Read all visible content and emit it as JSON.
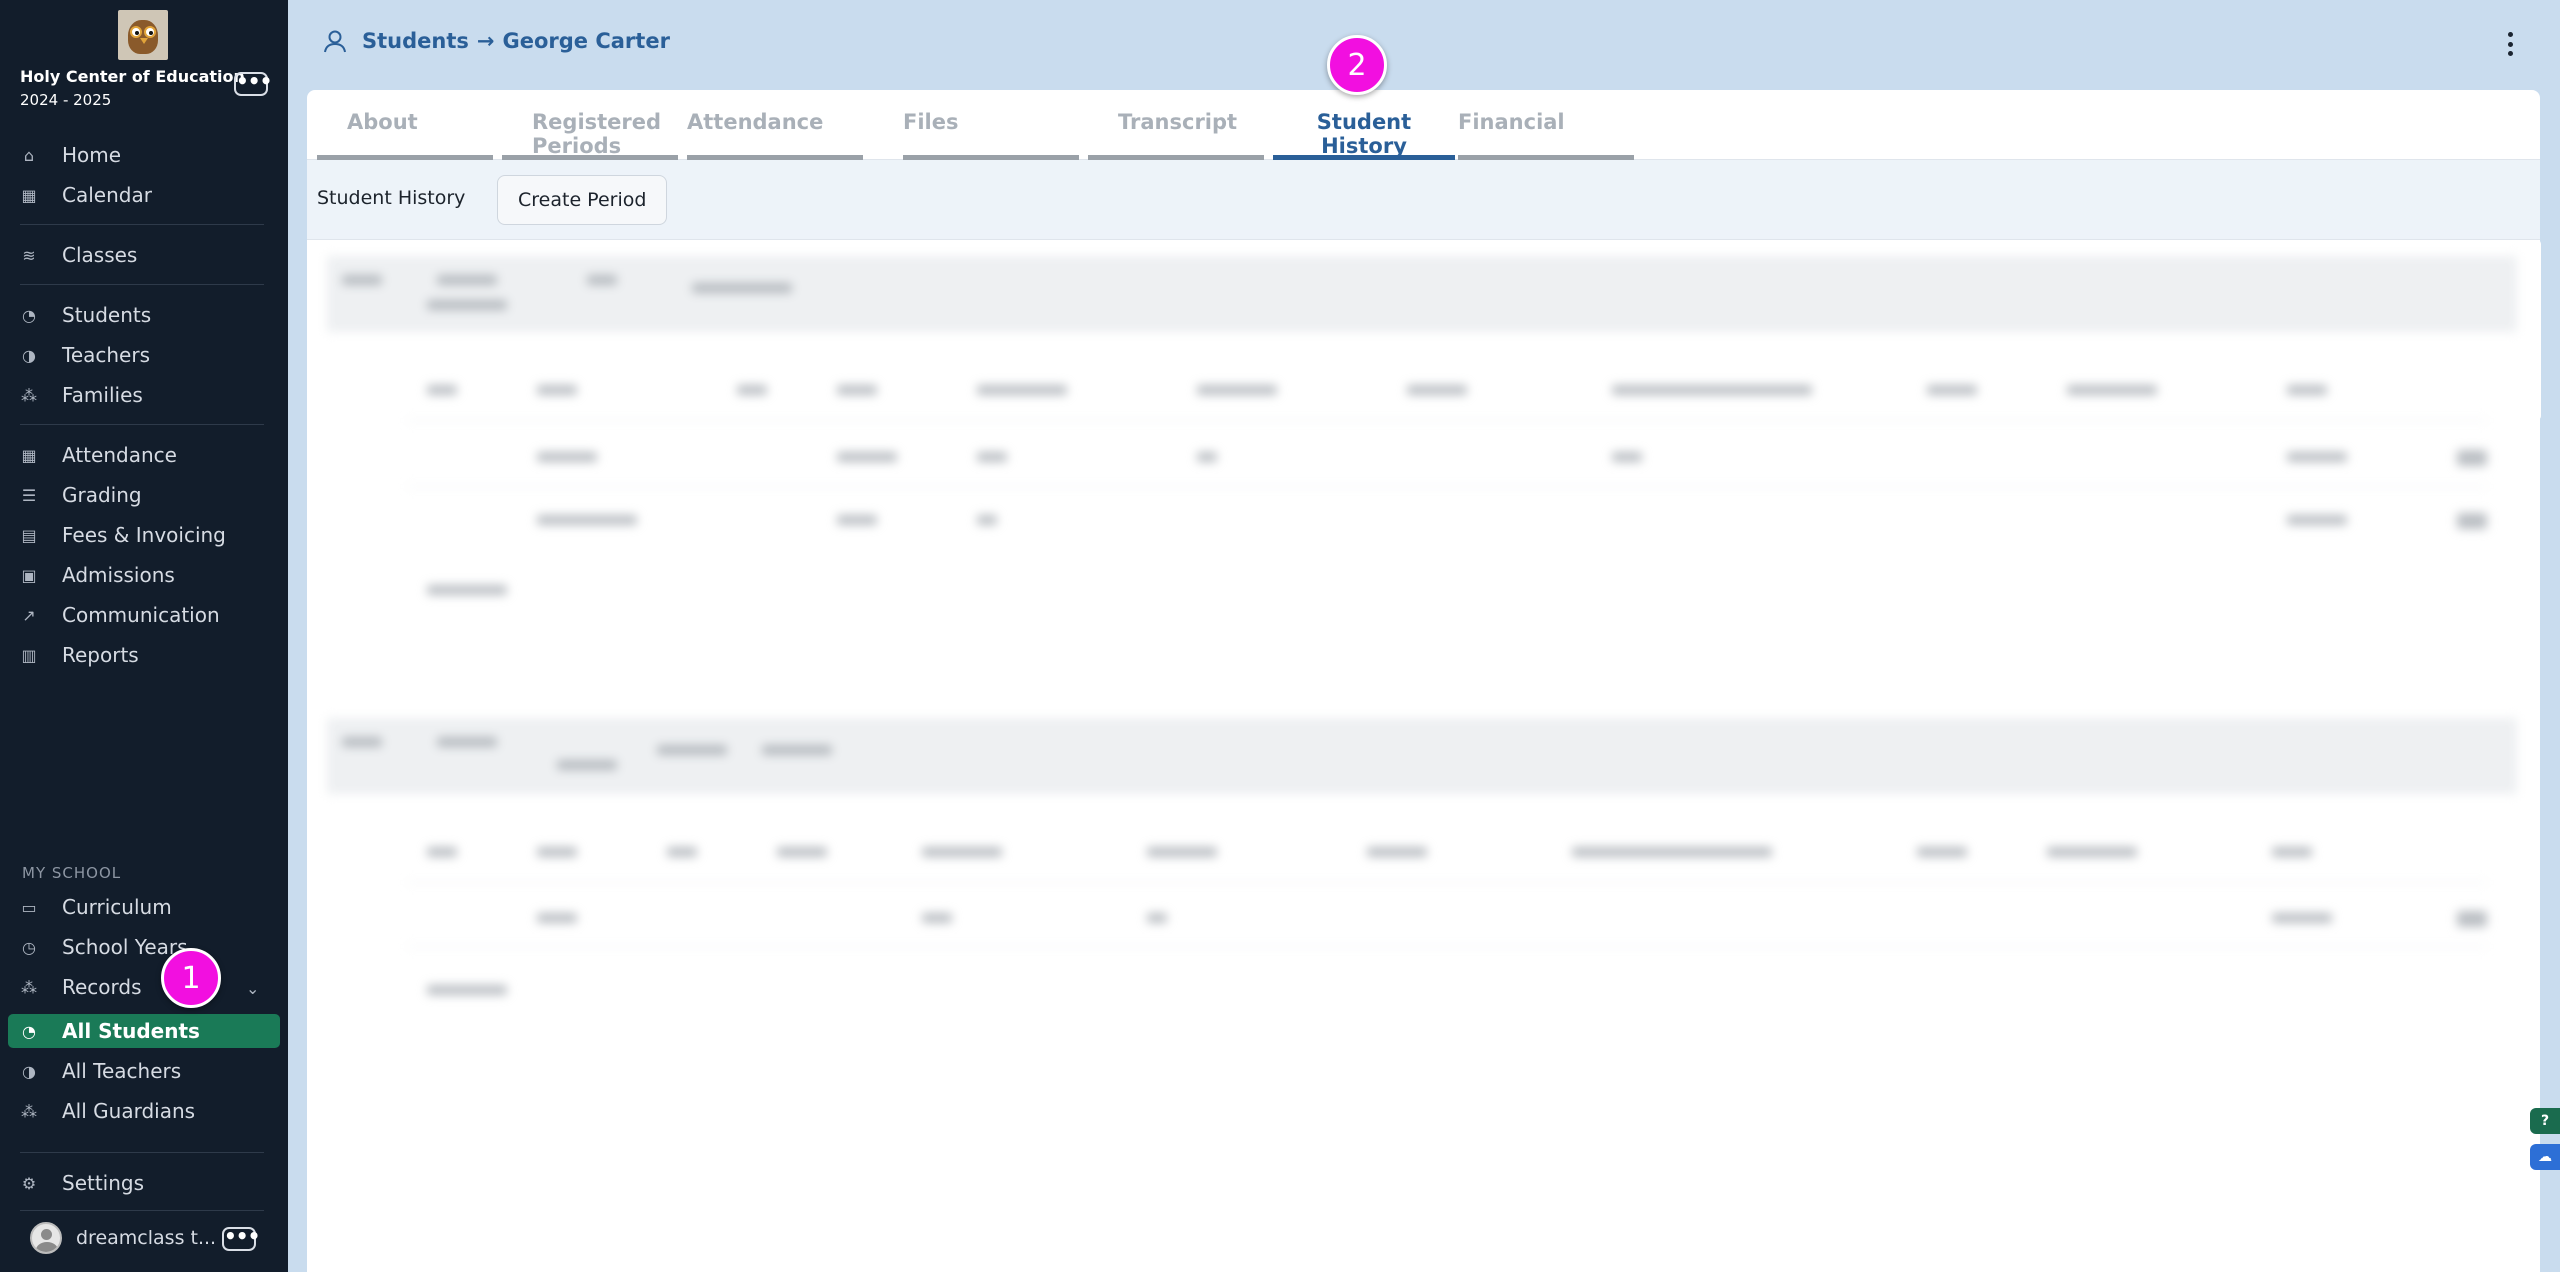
{
  "school": {
    "name": "Holy Center of Education",
    "year": "2024 - 2025",
    "menu_label": "•••"
  },
  "sidebar": {
    "items": [
      {
        "label": "Home",
        "icon": "home-icon",
        "glyph": "⌂"
      },
      {
        "label": "Calendar",
        "icon": "calendar-icon",
        "glyph": "▦"
      },
      {
        "label": "Classes",
        "icon": "classes-icon",
        "glyph": "≋"
      },
      {
        "label": "Students",
        "icon": "student-icon",
        "glyph": "◔"
      },
      {
        "label": "Teachers",
        "icon": "teacher-icon",
        "glyph": "◑"
      },
      {
        "label": "Families",
        "icon": "families-icon",
        "glyph": "⁂"
      },
      {
        "label": "Attendance",
        "icon": "attendance-icon",
        "glyph": "▦"
      },
      {
        "label": "Grading",
        "icon": "grading-icon",
        "glyph": "☰"
      },
      {
        "label": "Fees & Invoicing",
        "icon": "fees-icon",
        "glyph": "▤"
      },
      {
        "label": "Admissions",
        "icon": "admissions-icon",
        "glyph": "▣"
      },
      {
        "label": "Communication",
        "icon": "communication-icon",
        "glyph": "↗"
      },
      {
        "label": "Reports",
        "icon": "reports-icon",
        "glyph": "▥"
      }
    ],
    "section_label": "MY SCHOOL",
    "my_school": [
      {
        "label": "Curriculum",
        "icon": "book-icon",
        "glyph": "▭"
      },
      {
        "label": "School Years",
        "icon": "clock-icon",
        "glyph": "◷"
      },
      {
        "label": "Records",
        "icon": "records-icon",
        "glyph": "⁂"
      },
      {
        "label": "All Students",
        "icon": "student-icon",
        "glyph": "◔"
      },
      {
        "label": "All Teachers",
        "icon": "teacher-icon",
        "glyph": "◑"
      },
      {
        "label": "All Guardians",
        "icon": "guardians-icon",
        "glyph": "⁂"
      }
    ],
    "settings": {
      "label": "Settings",
      "icon": "gear-icon",
      "glyph": "⚙"
    },
    "user": {
      "name": "dreamclass t...",
      "menu_label": "•••"
    }
  },
  "header": {
    "breadcrumb": [
      "Students",
      "→",
      "George Carter"
    ]
  },
  "tabs": [
    "About",
    "Registered Periods",
    "Attendance",
    "Files",
    "Transcript",
    "Student History",
    "Financial"
  ],
  "active_tab": "Student History",
  "toolbar": {
    "title": "Student History",
    "create_label": "Create Period"
  },
  "annotations": [
    "1",
    "2"
  ],
  "widgets": {
    "help": "?",
    "chat": "☁"
  },
  "colors": {
    "sidebar_bg": "#121d2b",
    "active_green": "#1a7a57",
    "accent_blue": "#2a5f98",
    "badge_magenta": "#f20fe0",
    "page_bg": "#c9dcee"
  }
}
